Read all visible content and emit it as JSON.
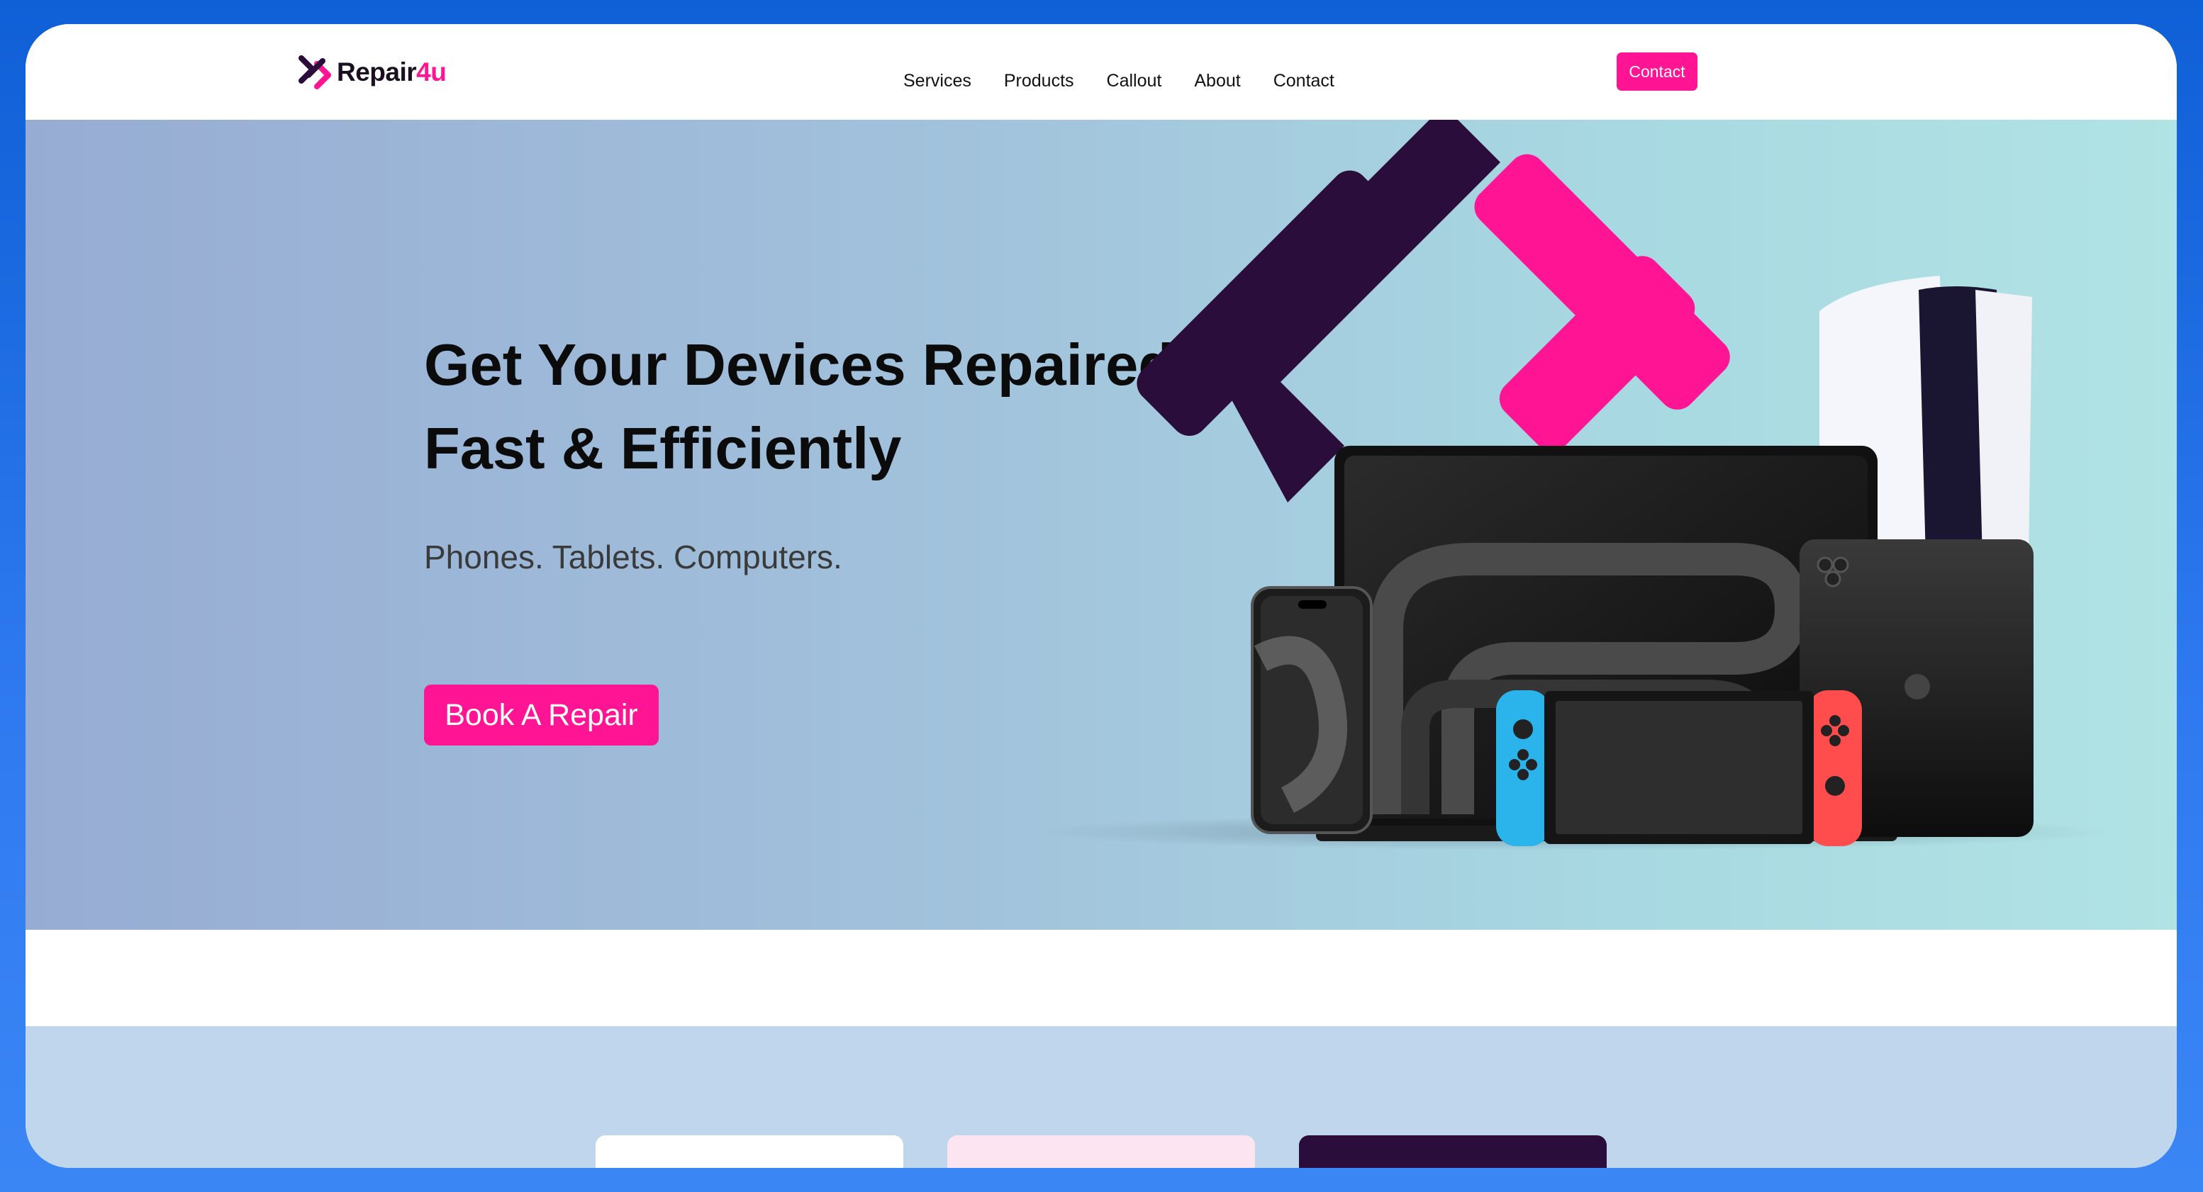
{
  "brand": {
    "name_main": "Repair",
    "name_accent": "4u",
    "accent": "#ff1493",
    "dark": "#2a0d3a"
  },
  "nav": {
    "items": [
      "Services",
      "Products",
      "Callout",
      "About",
      "Contact"
    ],
    "contact_button": "Contact"
  },
  "hero": {
    "title_line1": "Get Your Devices Repaired",
    "title_line2": "Fast & Efficiently",
    "subtitle": "Phones. Tablets. Computers.",
    "cta": "Book A Repair",
    "icons": [
      "repair4u-logo-mark",
      "macbook-icon",
      "iphone-icon",
      "ipad-icon",
      "nintendo-switch-icon",
      "playstation-5-icon"
    ]
  },
  "cards": [
    {
      "bg": "#ffffff"
    },
    {
      "bg": "#fce4f1"
    },
    {
      "bg": "#2a0d3a"
    }
  ]
}
